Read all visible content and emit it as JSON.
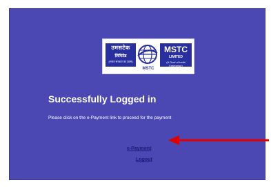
{
  "logo": {
    "left_title": "उमसटेक",
    "left_sub": "लिमिटेड",
    "left_small": "(भारत सरकार का उद्यम)",
    "right_title": "MSTC",
    "right_sub": "LIMITED",
    "right_small": "(A Govt of India Enterprise)",
    "bottom_text": "MSTC",
    "icon": "globe-icon"
  },
  "message": {
    "title": "Successfully Logged in",
    "instruction": "Please click on the e-Payment link to proceed for the payment"
  },
  "links": {
    "epayment": "e-Payment",
    "logout": "Logout"
  },
  "annotation": {
    "arrow_icon": "arrow-left-icon",
    "arrow_color": "#e00000"
  },
  "colors": {
    "panel_background": "#4b48b3",
    "link_color": "#1b1a7a",
    "text_color": "#ffffff"
  }
}
